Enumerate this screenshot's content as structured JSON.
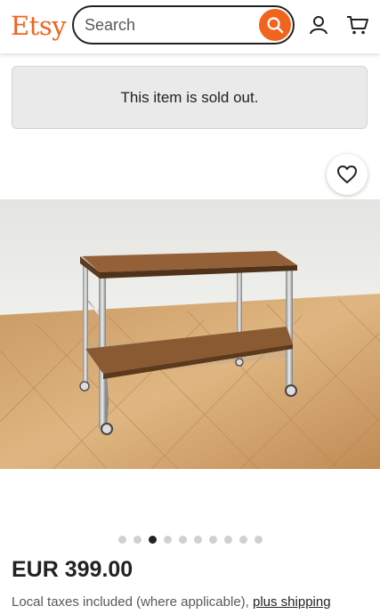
{
  "header": {
    "logo": "Etsy",
    "search_placeholder": "Search",
    "search_value": "",
    "icons": [
      "search-icon",
      "account-icon",
      "cart-icon"
    ]
  },
  "banner": {
    "text": "This item is sold out."
  },
  "favorite": {
    "icon": "heart-icon"
  },
  "gallery": {
    "image_count": 10,
    "active_index": 2,
    "image_alt": "Wood and chrome two-tier serving trolley on a parquet floor"
  },
  "listing": {
    "price": "EUR 399.00",
    "taxes_text": "Local taxes included (where applicable), ",
    "shipping_link": "plus shipping"
  },
  "colors": {
    "brand": "#f1641e",
    "text": "#222222",
    "banner_bg": "#eaeaea"
  }
}
